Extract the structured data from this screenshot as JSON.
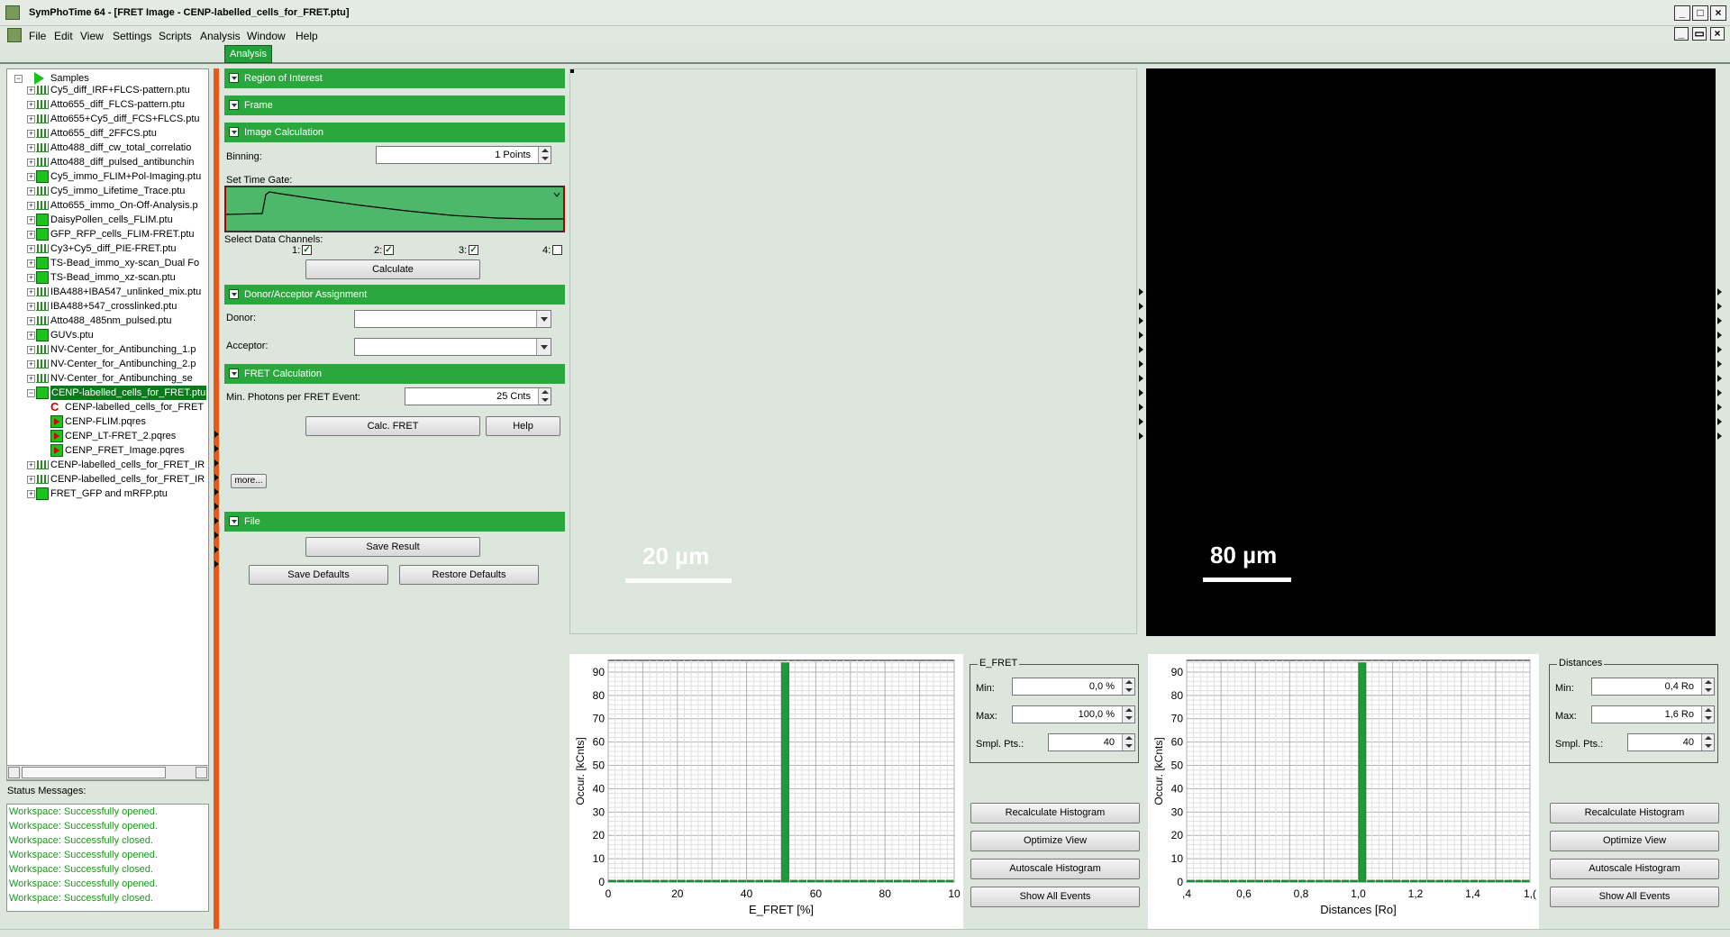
{
  "window": {
    "title": "SymPhoTime 64 - [FRET Image - CENP-labelled_cells_for_FRET.ptu]"
  },
  "menu": [
    "File",
    "Edit",
    "View",
    "Settings",
    "Scripts",
    "Analysis",
    "Window",
    "Help"
  ],
  "tab": {
    "label": "Analysis"
  },
  "tree": {
    "root": "Samples",
    "items": [
      {
        "label": "Cy5_diff_IRF+FLCS-pattern.ptu",
        "icon": "bars-icon"
      },
      {
        "label": "Atto655_diff_FLCS-pattern.ptu",
        "icon": "bars-icon"
      },
      {
        "label": "Atto655+Cy5_diff_FCS+FLCS.ptu",
        "icon": "bars-icon"
      },
      {
        "label": "Atto655_diff_2FFCS.ptu",
        "icon": "bars-icon"
      },
      {
        "label": "Atto488_diff_cw_total_correlatio",
        "icon": "bars-icon"
      },
      {
        "label": "Atto488_diff_pulsed_antibunchin",
        "icon": "bars-icon"
      },
      {
        "label": "Cy5_immo_FLIM+Pol-Imaging.ptu",
        "icon": "image-icon"
      },
      {
        "label": "Cy5_immo_Lifetime_Trace.ptu",
        "icon": "bars-icon"
      },
      {
        "label": "Atto655_immo_On-Off-Analysis.p",
        "icon": "bars-icon"
      },
      {
        "label": "DaisyPollen_cells_FLIM.ptu",
        "icon": "image-icon"
      },
      {
        "label": "GFP_RFP_cells_FLIM-FRET.ptu",
        "icon": "image-icon"
      },
      {
        "label": "Cy3+Cy5_diff_PIE-FRET.ptu",
        "icon": "bars-icon"
      },
      {
        "label": "TS-Bead_immo_xy-scan_Dual Fo",
        "icon": "image-icon"
      },
      {
        "label": "TS-Bead_immo_xz-scan.ptu",
        "icon": "image-icon"
      },
      {
        "label": "IBA488+IBA547_unlinked_mix.ptu",
        "icon": "bars-icon"
      },
      {
        "label": "IBA488+547_crosslinked.ptu",
        "icon": "bars-icon"
      },
      {
        "label": "Atto488_485nm_pulsed.ptu",
        "icon": "bars-icon"
      },
      {
        "label": "GUVs.ptu",
        "icon": "image-icon"
      },
      {
        "label": "NV-Center_for_Antibunching_1.p",
        "icon": "bars-icon"
      },
      {
        "label": "NV-Center_for_Antibunching_2.p",
        "icon": "bars-icon"
      },
      {
        "label": "NV-Center_for_Antibunching_se",
        "icon": "bars-icon"
      },
      {
        "label": "CENP-labelled_cells_for_FRET.ptu",
        "icon": "image-icon",
        "selected": true
      },
      {
        "label": "CENP-labelled_cells_for_FRET",
        "icon": "c-icon",
        "child": true
      },
      {
        "label": "CENP-FLIM.pqres",
        "icon": "pqres-icon",
        "child": true
      },
      {
        "label": "CENP_LT-FRET_2.pqres",
        "icon": "pqres-icon",
        "child": true
      },
      {
        "label": "CENP_FRET_Image.pqres",
        "icon": "pqres-icon",
        "child": true
      },
      {
        "label": "CENP-labelled_cells_for_FRET_IR",
        "icon": "bars-icon"
      },
      {
        "label": "CENP-labelled_cells_for_FRET_IR",
        "icon": "bars-icon"
      },
      {
        "label": "FRET_GFP and mRFP.ptu",
        "icon": "image-icon"
      }
    ]
  },
  "status": {
    "label": "Status Messages:",
    "messages": [
      "Workspace: Successfully opened.",
      "Workspace: Successfully opened.",
      "Workspace: Successfully closed.",
      "Workspace: Successfully opened.",
      "Workspace: Successfully closed.",
      "Workspace: Successfully opened.",
      "Workspace: Successfully closed."
    ]
  },
  "panel": {
    "roi": "Region of Interest",
    "frame": "Frame",
    "image_calc": "Image Calculation",
    "binning_label": "Binning:",
    "binning_value": "1 Points",
    "time_gate_label": "Set Time Gate:",
    "channels_label": "Select Data Channels:",
    "channels": [
      {
        "label": "1:",
        "checked": true
      },
      {
        "label": "2:",
        "checked": true
      },
      {
        "label": "3:",
        "checked": true
      },
      {
        "label": "4:",
        "checked": false
      }
    ],
    "calculate": "Calculate",
    "donor_acceptor": "Donor/Acceptor Assignment",
    "donor_label": "Donor:",
    "acceptor_label": "Acceptor:",
    "fret_calc": "FRET Calculation",
    "min_photons_label": "Min. Photons per FRET Event:",
    "min_photons_value": "25 Cnts",
    "calc_fret": "Calc. FRET",
    "help": "Help",
    "more": "more...",
    "file": "File",
    "save_result": "Save Result",
    "save_defaults": "Save Defaults",
    "restore_defaults": "Restore Defaults"
  },
  "images": {
    "left_scale": "20 µm",
    "right_scale": "80 µm"
  },
  "efret_controls": {
    "group": "E_FRET",
    "min_label": "Min:",
    "min_value": "0,0 %",
    "max_label": "Max:",
    "max_value": "100,0 %",
    "smpl_label": "Smpl. Pts.:",
    "smpl_value": "40",
    "recalc": "Recalculate Histogram",
    "optimize": "Optimize View",
    "autoscale": "Autoscale Histogram",
    "show_all": "Show All Events"
  },
  "dist_controls": {
    "group": "Distances",
    "min_label": "Min:",
    "min_value": "0,4 Ro",
    "max_label": "Max:",
    "max_value": "1,6 Ro",
    "smpl_label": "Smpl. Pts.:",
    "smpl_value": "40",
    "recalc": "Recalculate Histogram",
    "optimize": "Optimize View",
    "autoscale": "Autoscale Histogram",
    "show_all": "Show All Events"
  },
  "chart_data": [
    {
      "type": "bar",
      "xlabel": "E_FRET [%]",
      "ylabel": "Occur. [kCnts]",
      "xlim": [
        0,
        100
      ],
      "ylim": [
        0,
        95
      ],
      "x_ticks": [
        "0",
        "20",
        "40",
        "60",
        "80",
        "10"
      ],
      "y_ticks": [
        "0",
        "10",
        "20",
        "30",
        "40",
        "50",
        "60",
        "70",
        "80",
        "90"
      ],
      "bins": 40,
      "peak_x": 50,
      "peak_value": 94,
      "bar_color": "#1f9a3a"
    },
    {
      "type": "bar",
      "xlabel": "Distances [Ro]",
      "ylabel": "Occur. [kCnts]",
      "xlim": [
        0.4,
        1.6
      ],
      "ylim": [
        0,
        95
      ],
      "x_ticks": [
        ",4",
        "0,6",
        "0,8",
        "1,0",
        "1,2",
        "1,4",
        "1,("
      ],
      "y_ticks": [
        "0",
        "10",
        "20",
        "30",
        "40",
        "50",
        "60",
        "70",
        "80",
        "90"
      ],
      "bins": 40,
      "peak_x": 1.0,
      "peak_value": 94,
      "bar_color": "#1f9a3a"
    }
  ]
}
